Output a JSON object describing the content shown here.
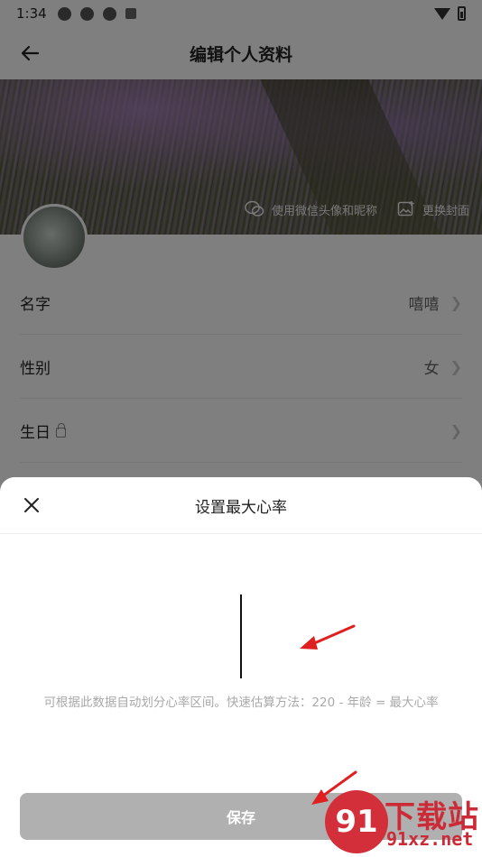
{
  "status_bar": {
    "time": "1:34"
  },
  "header": {
    "title": "编辑个人资料"
  },
  "cover": {
    "wechat_action": "使用微信头像和昵称",
    "change_cover_action": "更换封面"
  },
  "profile": {
    "rows": [
      {
        "label": "名字",
        "value": "嘻嘻",
        "locked": false
      },
      {
        "label": "性别",
        "value": "女",
        "locked": false
      },
      {
        "label": "生日",
        "value": "",
        "locked": true
      }
    ]
  },
  "sheet": {
    "title": "设置最大心率",
    "input_value": "",
    "hint": "可根据此数据自动划分心率区间。快速估算方法：220 - 年龄 = 最大心率",
    "save_label": "保存"
  },
  "watermark": {
    "badge": "91",
    "title": "下载站",
    "url": "91xz.net"
  },
  "colors": {
    "overlay": "#000000",
    "save_button_disabled": "#b0b0b0",
    "hint_text": "#a9a9a9",
    "annotation_arrow": "#e02020",
    "watermark": "#cc2a36"
  }
}
